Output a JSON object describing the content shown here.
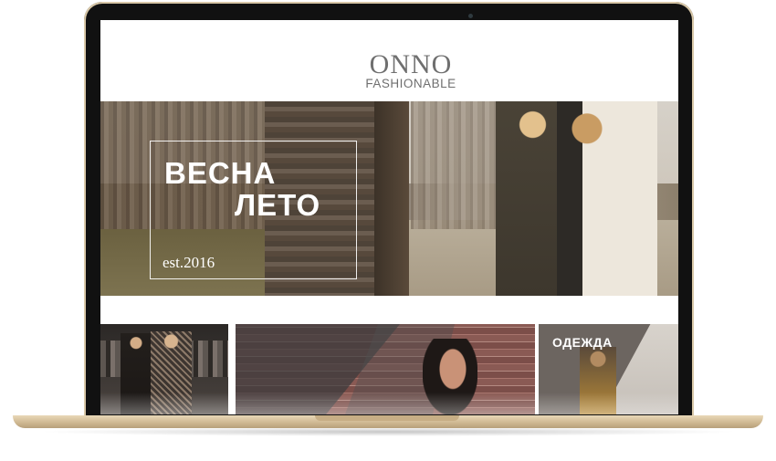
{
  "brand": {
    "name": "ONNO",
    "tagline": "FASHIONABLE"
  },
  "hero": {
    "title_line1": "ВЕСНА",
    "title_line2": "ЛЕТО",
    "established": "est.2016"
  },
  "tiles": [
    {
      "label": ""
    },
    {
      "label": ""
    },
    {
      "label": "ОДЕЖДА"
    }
  ],
  "colors": {
    "logo": "#6f6f6f",
    "frame": "#111111",
    "base": "#cdb690"
  }
}
